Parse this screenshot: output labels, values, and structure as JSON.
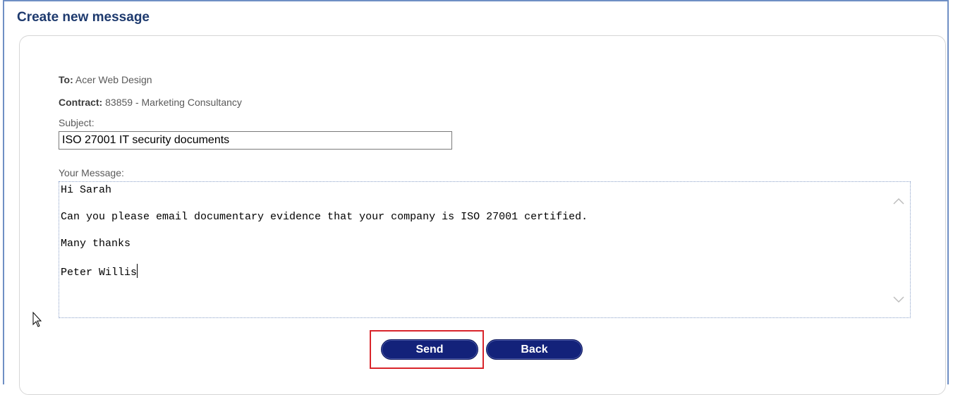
{
  "page": {
    "title": "Create new message"
  },
  "form": {
    "to_label": "To:",
    "to_value": "Acer Web Design",
    "contract_label": "Contract:",
    "contract_value": "83859 - Marketing Consultancy",
    "subject_label": "Subject:",
    "subject_value": "ISO 27001 IT security documents",
    "message_label": "Your Message:",
    "message_lines": [
      "Hi Sarah",
      "Can you please email documentary evidence that your company is ISO 27001 certified.",
      "Many thanks",
      "Peter Willis"
    ]
  },
  "buttons": {
    "send_label": "Send",
    "back_label": "Back"
  },
  "colors": {
    "header_text": "#1e3a6e",
    "button_bg": "#13227a",
    "highlight_border": "#d9252b"
  }
}
